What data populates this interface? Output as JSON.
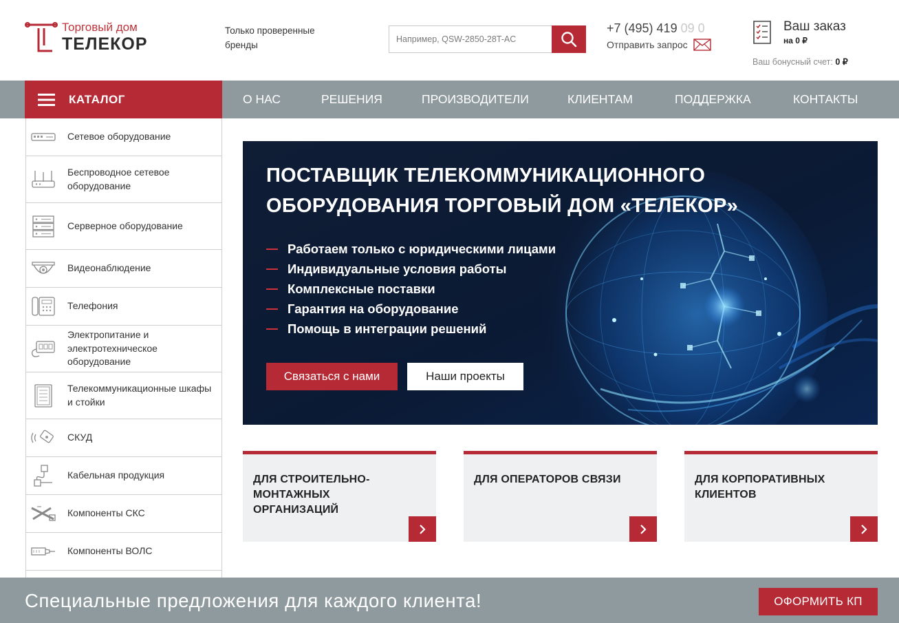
{
  "header": {
    "logo_top": "Торговый дом",
    "logo_bottom": "ТЕЛЕКОР",
    "tagline": "Только проверенные бренды",
    "search": {
      "placeholder": "Например, QSW-2850-28T-AC"
    },
    "phone_main": "+7 (495) 419",
    "phone_faded": " 09 0",
    "request_label": "Отправить запрос",
    "order_title": "Ваш заказ",
    "order_sum": "на 0 ₽",
    "bonus_label": "Ваш бонусный счет:",
    "bonus_value": "0 ₽"
  },
  "nav": {
    "catalog_label": "КАТАЛОГ",
    "items": [
      "О НАС",
      "РЕШЕНИЯ",
      "ПРОИЗВОДИТЕЛИ",
      "КЛИЕНТАМ",
      "ПОДДЕРЖКА",
      "КОНТАКТЫ"
    ]
  },
  "sidebar": {
    "items": [
      {
        "label": "Сетевое оборудование",
        "icon": "network-switch-icon"
      },
      {
        "label": "Беспроводное сетевое оборудование",
        "icon": "wifi-router-icon"
      },
      {
        "label": "Серверное оборудование",
        "icon": "server-icon"
      },
      {
        "label": "Видеонаблюдение",
        "icon": "camera-icon"
      },
      {
        "label": "Телефония",
        "icon": "phone-icon"
      },
      {
        "label": "Электропитание и электротехническое оборудование",
        "icon": "power-icon"
      },
      {
        "label": "Телекоммуникационные шкафы и стойки",
        "icon": "cabinet-icon"
      },
      {
        "label": "СКУД",
        "icon": "access-card-icon"
      },
      {
        "label": "Кабельная продукция",
        "icon": "cable-icon"
      },
      {
        "label": "Компоненты СКС",
        "icon": "tools-icon"
      },
      {
        "label": "Компоненты ВОЛС",
        "icon": "fiber-connector-icon"
      }
    ]
  },
  "banner": {
    "title": "ПОСТАВЩИК ТЕЛЕКОММУНИКАЦИОННОГО ОБОРУДОВАНИЯ ТОРГОВЫЙ ДОМ «ТЕЛЕКОР»",
    "bullets": [
      "Работаем только с юридическими лицами",
      "Индивидуальные условия работы",
      "Комплексные поставки",
      "Гарантия на оборудование",
      "Помощь в интеграции решений"
    ],
    "contact_button": "Связаться с нами",
    "projects_button": "Наши проекты"
  },
  "cards": [
    {
      "title": "ДЛЯ СТРОИТЕЛЬНО-МОНТАЖНЫХ ОРГАНИЗАЦИЙ"
    },
    {
      "title": "ДЛЯ ОПЕРАТОРОВ СВЯЗИ"
    },
    {
      "title": "ДЛЯ КОРПОРАТИВНЫХ КЛИЕНТОВ"
    }
  ],
  "promo": {
    "text": "Специальные предложения для каждого клиента!",
    "button": "ОФОРМИТЬ КП"
  },
  "colors": {
    "accent": "#b52a34",
    "nav_gray": "#8f9a9e",
    "card_bg": "#eef0f1",
    "banner_dark": "#0b1a33"
  }
}
